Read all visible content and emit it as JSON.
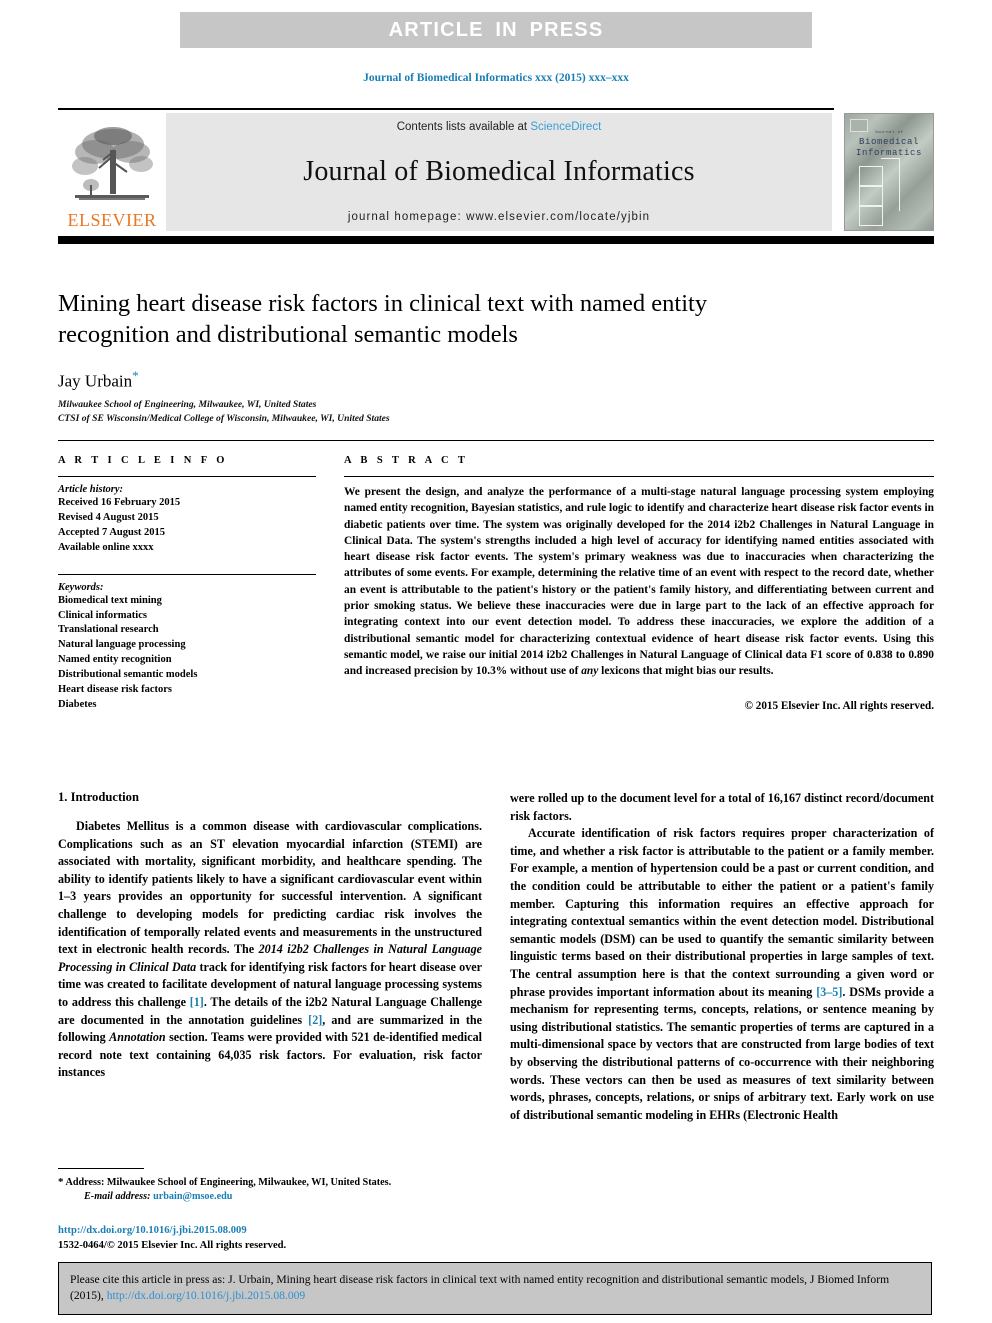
{
  "banner": {
    "text": "ARTICLE  IN  PRESS"
  },
  "running_citation": "Journal of Biomedical Informatics xxx (2015) xxx–xxx",
  "masthead": {
    "contents_prefix": "Contents lists available at ",
    "sciencedirect": "ScienceDirect",
    "journal_title": "Journal of Biomedical Informatics",
    "homepage": "journal homepage: www.elsevier.com/locate/yjbin",
    "publisher_wordmark": "ELSEVIER",
    "cover": {
      "journal_word": "Journal of",
      "line1": "Biomedical",
      "line2": "Informatics"
    }
  },
  "article": {
    "title": "Mining heart disease risk factors in clinical text with named entity recognition and distributional semantic models",
    "author": "Jay Urbain",
    "corresponding_marker": "*",
    "affiliations": [
      "Milwaukee School of Engineering, Milwaukee, WI, United States",
      "CTSI of SE Wisconsin/Medical College of Wisconsin, Milwaukee, WI, United States"
    ]
  },
  "article_info": {
    "heading": "A R T I C L E    I N F O",
    "history_label": "Article history:",
    "history": [
      "Received 16 February 2015",
      "Revised 4 August 2015",
      "Accepted 7 August 2015",
      "Available online xxxx"
    ],
    "keywords_label": "Keywords:",
    "keywords": [
      "Biomedical text mining",
      "Clinical informatics",
      "Translational research",
      "Natural language processing",
      "Named entity recognition",
      "Distributional semantic models",
      "Heart disease risk factors",
      "Diabetes"
    ]
  },
  "abstract": {
    "heading": "A B S T R A C T",
    "p1a": "We present the design, and analyze the performance of a multi-stage natural language processing system employing named entity recognition, Bayesian statistics, and rule logic to identify and characterize heart disease risk factor events in diabetic patients over time. The system was originally developed for the 2014 i2b2 Challenges in Natural Language in Clinical Data. The system's strengths included a high level of accuracy for identifying named entities associated with heart disease risk factor events. The system's primary weakness was due to inaccuracies when characterizing the attributes of some events. For example, determining the relative time of an event with respect to the record date, whether an event is attributable to the patient's history or the patient's family history, and differentiating between current and prior smoking status. We believe these inaccuracies were due in large part to the lack of an effective approach for integrating context into our event detection model. To address these inaccuracies, we explore the addition of a distributional semantic model for characterizing contextual evidence of heart disease risk factor events. Using this semantic model, we raise our initial 2014 i2b2 Challenges in Natural Language of Clinical data F1 score of 0.838 to 0.890 and increased precision by 10.3% without use of ",
    "p1_italic": "any",
    "p1b": " lexicons that might bias our results.",
    "copyright": "© 2015 Elsevier Inc. All rights reserved."
  },
  "body": {
    "section_heading": "1. Introduction",
    "left_p1a": "Diabetes Mellitus is a common disease with cardiovascular complications. Complications such as an ST elevation myocardial infarction (STEMI) are associated with mortality, significant morbidity, and healthcare spending. The ability to identify patients likely to have a significant cardiovascular event within 1–3 years provides an opportunity for successful intervention. A significant challenge to developing models for predicting cardiac risk involves the identification of temporally related events and measurements in the unstructured text in electronic health records. The ",
    "left_p1_ital1": "2014 i2b2 Challenges in Natural Language Processing in Clinical Data",
    "left_p1b": " track for identifying risk factors for heart disease over time was created to facilitate development of natural language processing systems to address this challenge ",
    "left_ref1": "[1]",
    "left_p1c": ". The details of the i2b2 Natural Language Challenge are documented in the annotation guidelines ",
    "left_ref2": "[2]",
    "left_p1d": ", and are summarized in the following ",
    "left_p1_ital2": "Annotation",
    "left_p1e": " section. Teams were provided with 521 de-identified medical record note text containing 64,035 risk factors. For evaluation, risk factor instances",
    "right_p1": "were rolled up to the document level for a total of 16,167 distinct record/document risk factors.",
    "right_p2a": "Accurate identification of risk factors requires proper characterization of time, and whether a risk factor is attributable to the patient or a family member. For example, a mention of hypertension could be a past or current condition, and the condition could be attributable to either the patient or a patient's family member. Capturing this information requires an effective approach for integrating contextual semantics within the event detection model. Distributional semantic models (DSM) can be used to quantify the semantic similarity between linguistic terms based on their distributional properties in large samples of text. The central assumption here is that the context surrounding a given word or phrase provides important information about its meaning ",
    "right_ref1": "[3–5]",
    "right_p2b": ". DSMs provide a mechanism for representing terms, concepts, relations, or sentence meaning by using distributional statistics. The semantic properties of terms are captured in a multi-dimensional space by vectors that are constructed from large bodies of text by observing the distributional patterns of co-occurrence with their neighboring words. These vectors can then be used as measures of text similarity between words, phrases, concepts, relations, or snips of arbitrary text. Early work on use of distributional semantic modeling in EHRs (Electronic Health"
  },
  "footnote": {
    "star": "*",
    "address": " Address: Milwaukee School of Engineering, Milwaukee, WI, United States.",
    "email_label": "E-mail address:",
    "email": "urbain@msoe.edu"
  },
  "doi_block": {
    "doi_url": "http://dx.doi.org/10.1016/j.jbi.2015.08.009",
    "issn_line": "1532-0464/© 2015 Elsevier Inc. All rights reserved."
  },
  "cite_footer": {
    "text_a": "Please cite this article in press as: J. Urbain, Mining heart disease risk factors in clinical text with named entity recognition and distributional semantic models, J Biomed Inform (2015), ",
    "link": "http://dx.doi.org/10.1016/j.jbi.2015.08.009"
  },
  "colors": {
    "link_blue": "#1b7fb5",
    "elsevier_orange": "#e87722",
    "banner_gray": "#c6c6c6",
    "masthead_gray": "#e6e6e6"
  }
}
